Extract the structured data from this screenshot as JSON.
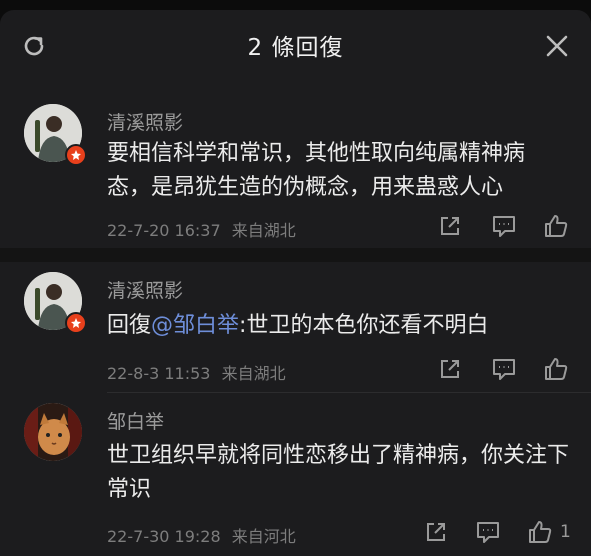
{
  "header": {
    "title": "2 條回復"
  },
  "comments": [
    {
      "name": "清溪照影",
      "text": "要相信科学和常识，其他性取向纯属精神病态，是昂犹生造的伪概念，用来蛊惑人心",
      "date": "22-7-20 16:37",
      "location": "来自湖北"
    },
    {
      "name": "清溪照影",
      "reply_prefix": "回復",
      "mention": "@邹白举",
      "text": ":世卫的本色你还看不明白",
      "date": "22-8-3 11:53",
      "location": "来自湖北"
    },
    {
      "name": "邹白举",
      "text": "世卫组织早就将同性恋移出了精神病，你关注下常识",
      "date": "22-7-30 19:28",
      "location": "来自河北",
      "likes": "1"
    }
  ],
  "colors": {
    "mention": "#6e8ed9",
    "badge": "#e8401c",
    "background": "#1c1c1e"
  },
  "icons": [
    "refresh-icon",
    "close-icon",
    "share-icon",
    "comment-icon",
    "like-icon",
    "vip-badge-icon"
  ]
}
